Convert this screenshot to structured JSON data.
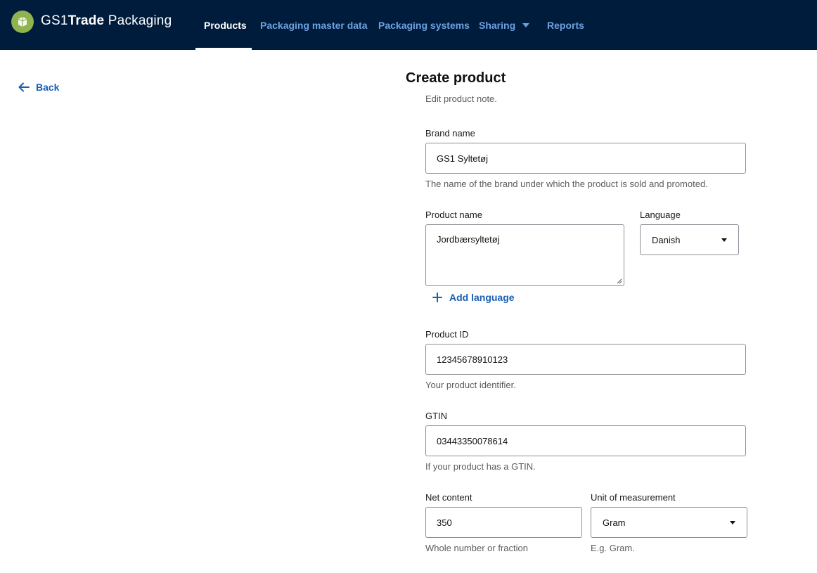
{
  "header": {
    "brand_prefix": "GS1",
    "brand_bold": "Trade",
    "brand_suffix": " Packaging",
    "nav": {
      "products": "Products",
      "packaging_master_data": "Packaging master data",
      "packaging_systems": "Packaging systems",
      "sharing": "Sharing",
      "reports": "Reports"
    },
    "active_nav": "Products"
  },
  "back": {
    "label": "Back"
  },
  "form": {
    "title": "Create product",
    "subtitle": "Edit product note.",
    "brand_name": {
      "label": "Brand name",
      "value": "GS1 Syltetøj",
      "hint": "The name of the brand under which the product is sold and promoted."
    },
    "product_name": {
      "label": "Product name",
      "value": "Jordbærsyltetøj"
    },
    "language": {
      "label": "Language",
      "value": "Danish"
    },
    "add_language": "Add language",
    "product_id": {
      "label": "Product ID",
      "value": "12345678910123",
      "hint": "Your product identifier."
    },
    "gtin": {
      "label": "GTIN",
      "value": "03443350078614",
      "hint": "If your product has a GTIN."
    },
    "net_content": {
      "label": "Net content",
      "value": "350",
      "hint": "Whole number or fraction"
    },
    "unit": {
      "label": "Unit of measurement",
      "value": "Gram",
      "hint": "E.g. Gram."
    }
  },
  "colors": {
    "header_bg": "#001c3d",
    "nav_link": "#6da1e0",
    "link": "#1a5fb4",
    "logo": "#8fb34f"
  }
}
